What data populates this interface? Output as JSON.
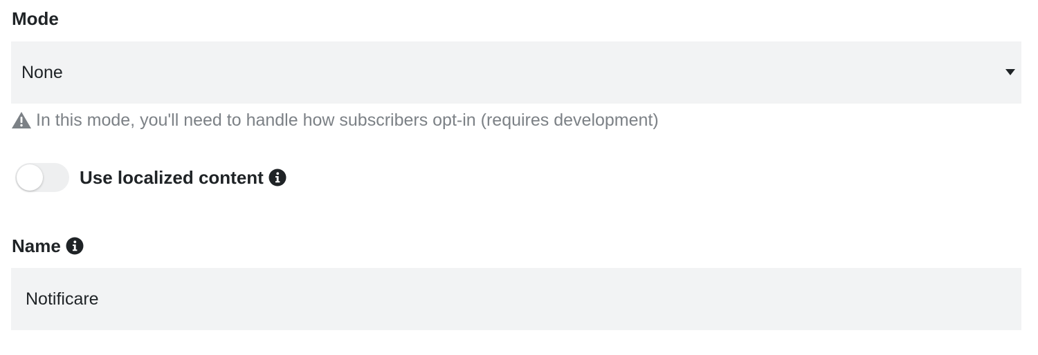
{
  "mode": {
    "label": "Mode",
    "selected": "None",
    "hint": "In this mode, you'll need to handle how subscribers opt-in (requires development)",
    "hint_icon": "warning-icon",
    "caret_icon": "caret-down-icon"
  },
  "localized": {
    "label": "Use localized content",
    "enabled": false,
    "info_icon": "info-icon"
  },
  "name": {
    "label": "Name",
    "value": "Notificare",
    "info_icon": "info-icon"
  },
  "colors": {
    "field_bg": "#f2f3f4",
    "text": "#1f2326",
    "muted": "#7c8186"
  }
}
